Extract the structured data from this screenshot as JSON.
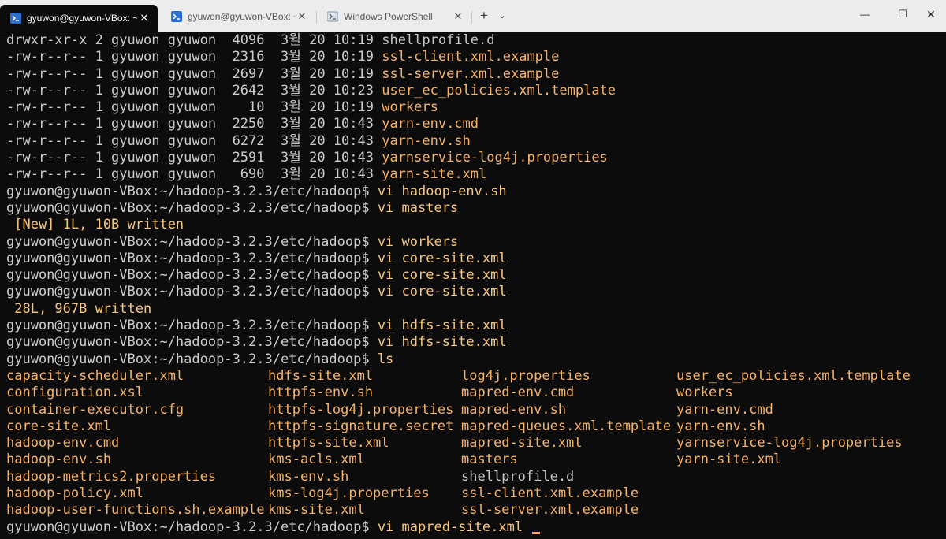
{
  "tabs": [
    {
      "title": "gyuwon@gyuwon-VBox: ~/h",
      "active": true
    },
    {
      "title": "gyuwon@gyuwon-VBox: ~/da",
      "active": false
    },
    {
      "title": "Windows PowerShell",
      "active": false
    }
  ],
  "tabbar": {
    "new_tab": "+",
    "dropdown": "⌄"
  },
  "window_controls": {
    "minimize": "—",
    "maximize": "☐",
    "close": "✕"
  },
  "terminal": {
    "prompt": "gyuwon@gyuwon-VBox:~/hadoop-3.2.3/etc/hadoop$",
    "listing": [
      {
        "meta": "drwxr-xr-x 2 gyuwon gyuwon  4096  3월 20 10:19",
        "name": "shellprofile.d"
      },
      {
        "meta": "-rw-r--r-- 1 gyuwon gyuwon  2316  3월 20 10:19",
        "name": "ssl-client.xml.example"
      },
      {
        "meta": "-rw-r--r-- 1 gyuwon gyuwon  2697  3월 20 10:19",
        "name": "ssl-server.xml.example"
      },
      {
        "meta": "-rw-r--r-- 1 gyuwon gyuwon  2642  3월 20 10:23",
        "name": "user_ec_policies.xml.template"
      },
      {
        "meta": "-rw-r--r-- 1 gyuwon gyuwon    10  3월 20 10:19",
        "name": "workers"
      },
      {
        "meta": "-rw-r--r-- 1 gyuwon gyuwon  2250  3월 20 10:43",
        "name": "yarn-env.cmd"
      },
      {
        "meta": "-rw-r--r-- 1 gyuwon gyuwon  6272  3월 20 10:43",
        "name": "yarn-env.sh"
      },
      {
        "meta": "-rw-r--r-- 1 gyuwon gyuwon  2591  3월 20 10:43",
        "name": "yarnservice-log4j.properties"
      },
      {
        "meta": "-rw-r--r-- 1 gyuwon gyuwon   690  3월 20 10:43",
        "name": "yarn-site.xml"
      }
    ],
    "history": [
      {
        "type": "cmd",
        "text": "vi hadoop-env.sh"
      },
      {
        "type": "cmd",
        "text": "vi masters"
      },
      {
        "type": "out",
        "text": " [New] 1L, 10B written"
      },
      {
        "type": "cmd",
        "text": "vi workers"
      },
      {
        "type": "cmd",
        "text": "vi core-site.xml"
      },
      {
        "type": "cmd",
        "text": "vi core-site.xml"
      },
      {
        "type": "cmd",
        "text": "vi core-site.xml"
      },
      {
        "type": "out",
        "text": " 28L, 967B written"
      },
      {
        "type": "cmd",
        "text": "vi hdfs-site.xml"
      },
      {
        "type": "cmd",
        "text": "vi hdfs-site.xml"
      },
      {
        "type": "cmd",
        "text": "ls"
      }
    ],
    "ls_rows": [
      [
        "capacity-scheduler.xml",
        "hdfs-site.xml",
        "log4j.properties",
        "user_ec_policies.xml.template"
      ],
      [
        "configuration.xsl",
        "httpfs-env.sh",
        "mapred-env.cmd",
        "workers"
      ],
      [
        "container-executor.cfg",
        "httpfs-log4j.properties",
        "mapred-env.sh",
        "yarn-env.cmd"
      ],
      [
        "core-site.xml",
        "httpfs-signature.secret",
        "mapred-queues.xml.template",
        "yarn-env.sh"
      ],
      [
        "hadoop-env.cmd",
        "httpfs-site.xml",
        "mapred-site.xml",
        "yarnservice-log4j.properties"
      ],
      [
        "hadoop-env.sh",
        "kms-acls.xml",
        "masters",
        "yarn-site.xml"
      ],
      [
        "hadoop-metrics2.properties",
        "kms-env.sh",
        "shellprofile.d",
        ""
      ],
      [
        "hadoop-policy.xml",
        "kms-log4j.properties",
        "ssl-client.xml.example",
        ""
      ],
      [
        "hadoop-user-functions.sh.example",
        "kms-site.xml",
        "ssl-server.xml.example",
        ""
      ]
    ],
    "directory_names": [
      "shellprofile.d"
    ],
    "current_command": "vi mapred-site.xml"
  }
}
